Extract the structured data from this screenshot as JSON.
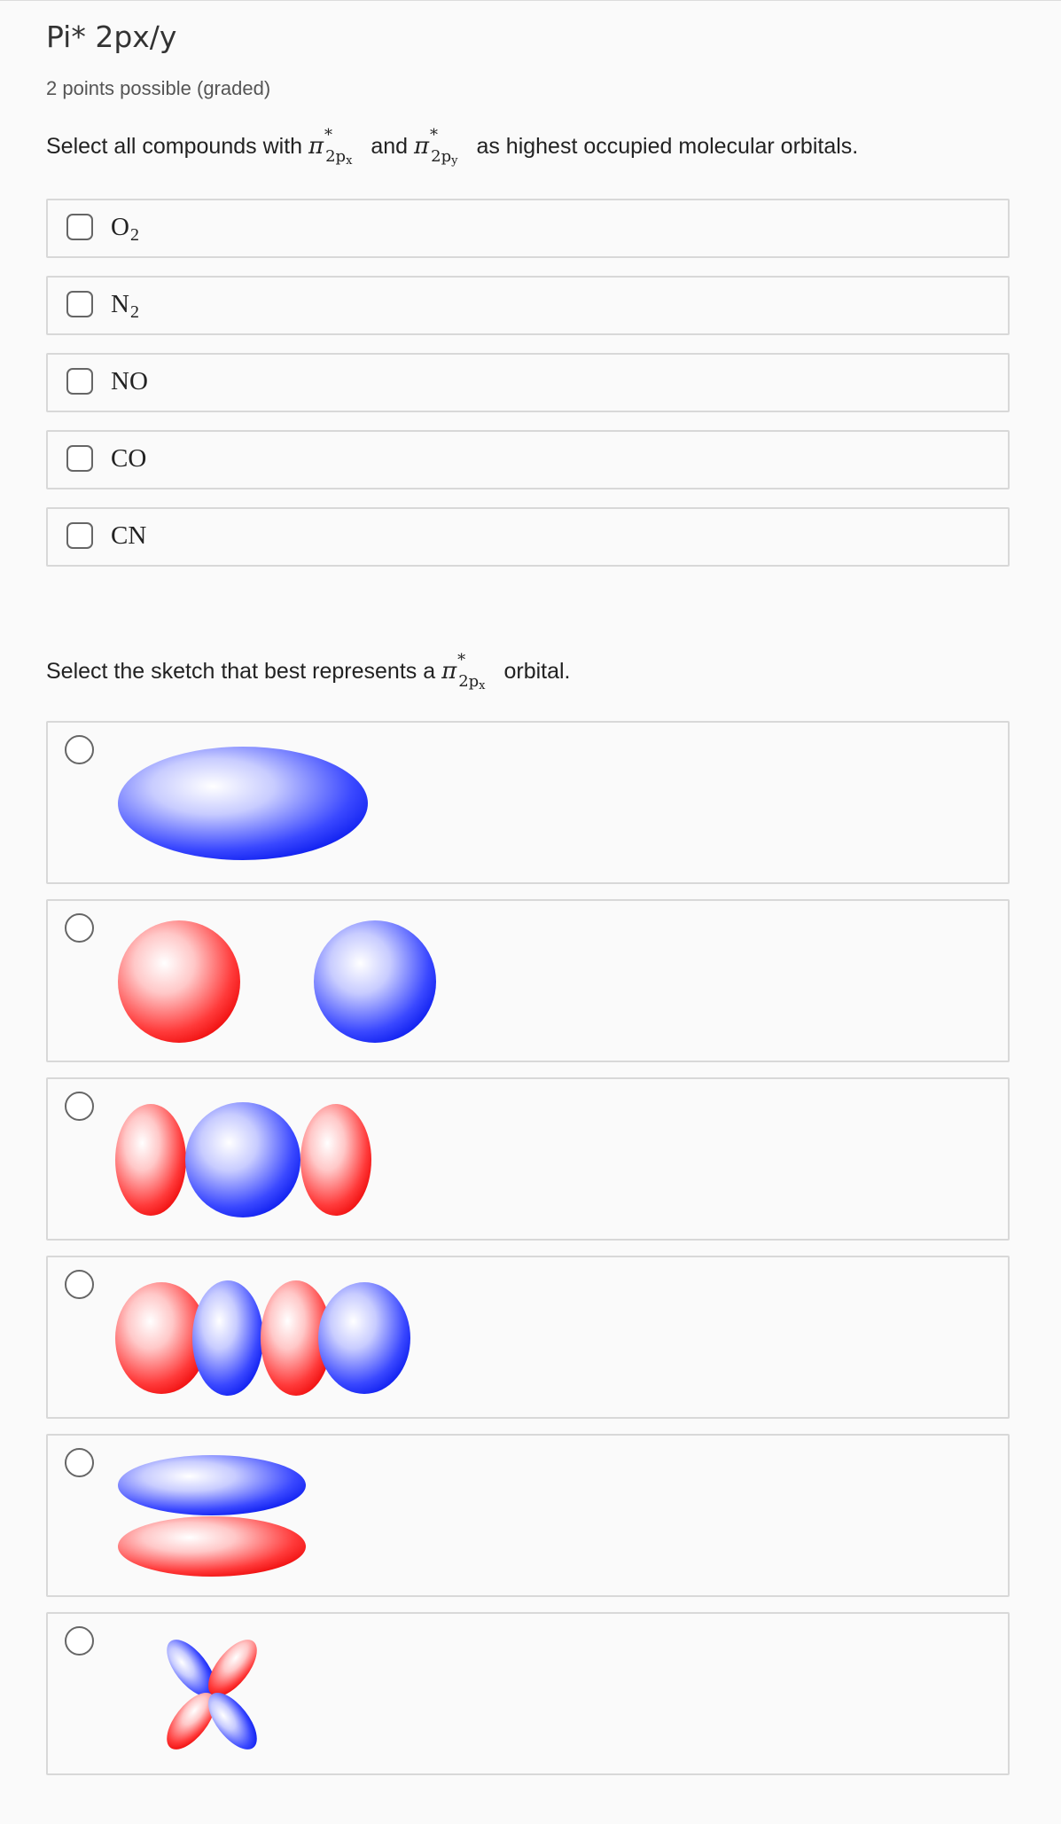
{
  "problem": {
    "title": "Pi* 2px/y",
    "points": "2 points possible (graded)"
  },
  "question1": {
    "prompt_before": "Select all compounds with",
    "pi_symbol": "π",
    "star": "*",
    "sub_px": "2p",
    "sub_px_small": "x",
    "sub_py": "2p",
    "sub_py_small": "y",
    "and": "and",
    "prompt_after": "as highest occupied molecular orbitals.",
    "options": [
      {
        "formula": "O",
        "subscript": "2"
      },
      {
        "formula": "N",
        "subscript": "2"
      },
      {
        "formula": "NO",
        "subscript": ""
      },
      {
        "formula": "CO",
        "subscript": ""
      },
      {
        "formula": "CN",
        "subscript": ""
      }
    ]
  },
  "question2": {
    "prompt_before": "Select the sketch that best represents a",
    "pi_symbol": "π",
    "star": "*",
    "sub": "2p",
    "sub_small": "x",
    "prompt_after": "orbital.",
    "options": [
      {
        "sketch": "single-blue-ellipsoid"
      },
      {
        "sketch": "red-and-blue-spheres-separated"
      },
      {
        "sketch": "red-blue-red-lobes"
      },
      {
        "sketch": "red-blue-red-blue-lobes"
      },
      {
        "sketch": "blue-over-red-flat-lobes"
      },
      {
        "sketch": "four-lobe-cloverleaf"
      }
    ]
  },
  "colors": {
    "phase_positive": "#1a2cff",
    "phase_negative": "#ff1a1a",
    "border": "#d8d8d8",
    "background": "#fafafa"
  }
}
